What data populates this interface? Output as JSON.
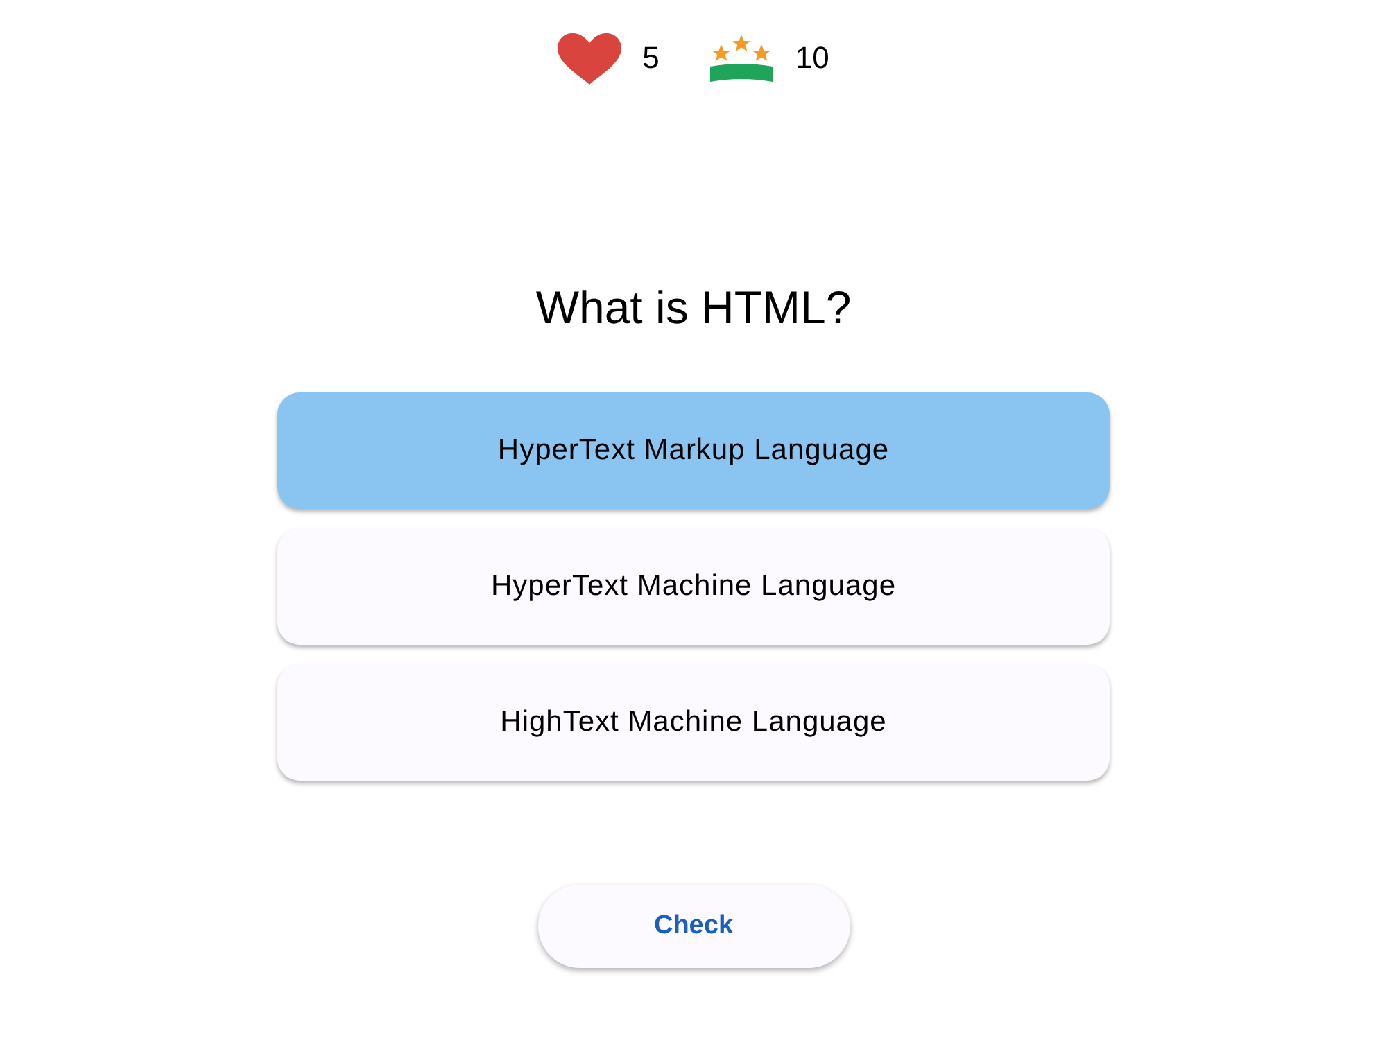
{
  "stats": [
    {
      "kind": "lives",
      "value": "5"
    },
    {
      "kind": "score",
      "value": "10"
    }
  ],
  "question": "What is HTML?",
  "options": [
    {
      "label": "HyperText Markup Language",
      "selected": true
    },
    {
      "label": "HyperText Machine Language",
      "selected": false
    },
    {
      "label": "HighText Machine Language",
      "selected": false
    }
  ],
  "check_button": {
    "label": "Check"
  }
}
